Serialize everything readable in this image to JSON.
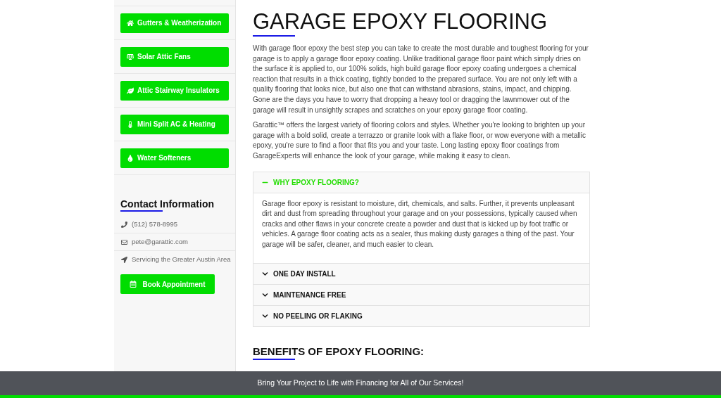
{
  "sidebar": {
    "services": [
      {
        "label": "Gutters & Weatherization"
      },
      {
        "label": "Solar Attic Fans"
      },
      {
        "label": "Attic Stairway Insulators"
      },
      {
        "label": "Mini Split AC & Heating"
      },
      {
        "label": "Water Softeners"
      }
    ],
    "contact": {
      "heading": "Contact Information",
      "items": [
        {
          "kind": "phone",
          "text": "(512) 578-8995"
        },
        {
          "kind": "email",
          "text": "pete@garattic.com"
        },
        {
          "kind": "location",
          "text": "Servicing the Greater Austin Area"
        }
      ],
      "button": "Book Appointment"
    }
  },
  "main": {
    "title": "GARAGE EPOXY FLOORING",
    "paragraphs": [
      "With garage floor epoxy the best step you can take to create the most durable and toughest flooring for your garage is to apply a garage floor epoxy coating.  Unlike traditional garage floor paint which simply dries on the surface it is applied to, our 100% solids, high build garage floor epoxy coating undergoes a chemical reaction that results in a thick coating, tightly bonded to the prepared surface.  You are not only left with a quality flooring that looks nice, but also one that can withstand abrasions, stains, impact, and chipping.  Gone are the days you have to worry that dropping a heavy tool or dragging the lawnmower out of the garage will result in unsightly scrapes and scratches on your epoxy garage floor coating.",
      "Garattic™ offers the largest variety of flooring colors and styles. Whether you're looking to brighten up your garage with a bold solid, create a terrazzo or granite look with a flake floor, or wow everyone with a metallic epoxy, you're sure to find a floor that fits you and your taste. Long lasting epoxy floor coatings from GarageExperts will enhance the look of your garage, while making it easy to clean."
    ],
    "accordion": [
      {
        "title": "WHY EPOXY FLOORING?",
        "expanded": true,
        "body": "Garage floor epoxy is resistant to moisture, dirt, chemicals, and salts. Further, it prevents unpleasant dirt and dust from spreading throughout your garage and on your possessions, typically caused when cracks and other flaws in your concrete create a powder and dust that is kicked up by foot traffic or vehicles.  A garage floor coating acts as a sealer, thus making dusty garages a thing of the past. Your garage will be safer, cleaner, and much easier to clean."
      },
      {
        "title": "ONE DAY INSTALL",
        "expanded": false
      },
      {
        "title": "MAINTENANCE FREE",
        "expanded": false
      },
      {
        "title": "NO PEELING OR FLAKING",
        "expanded": false
      }
    ],
    "subheading": "BENEFITS OF EPOXY FLOORING:"
  },
  "banner": "Bring Your Project to Life with Financing for All of Our Services!"
}
